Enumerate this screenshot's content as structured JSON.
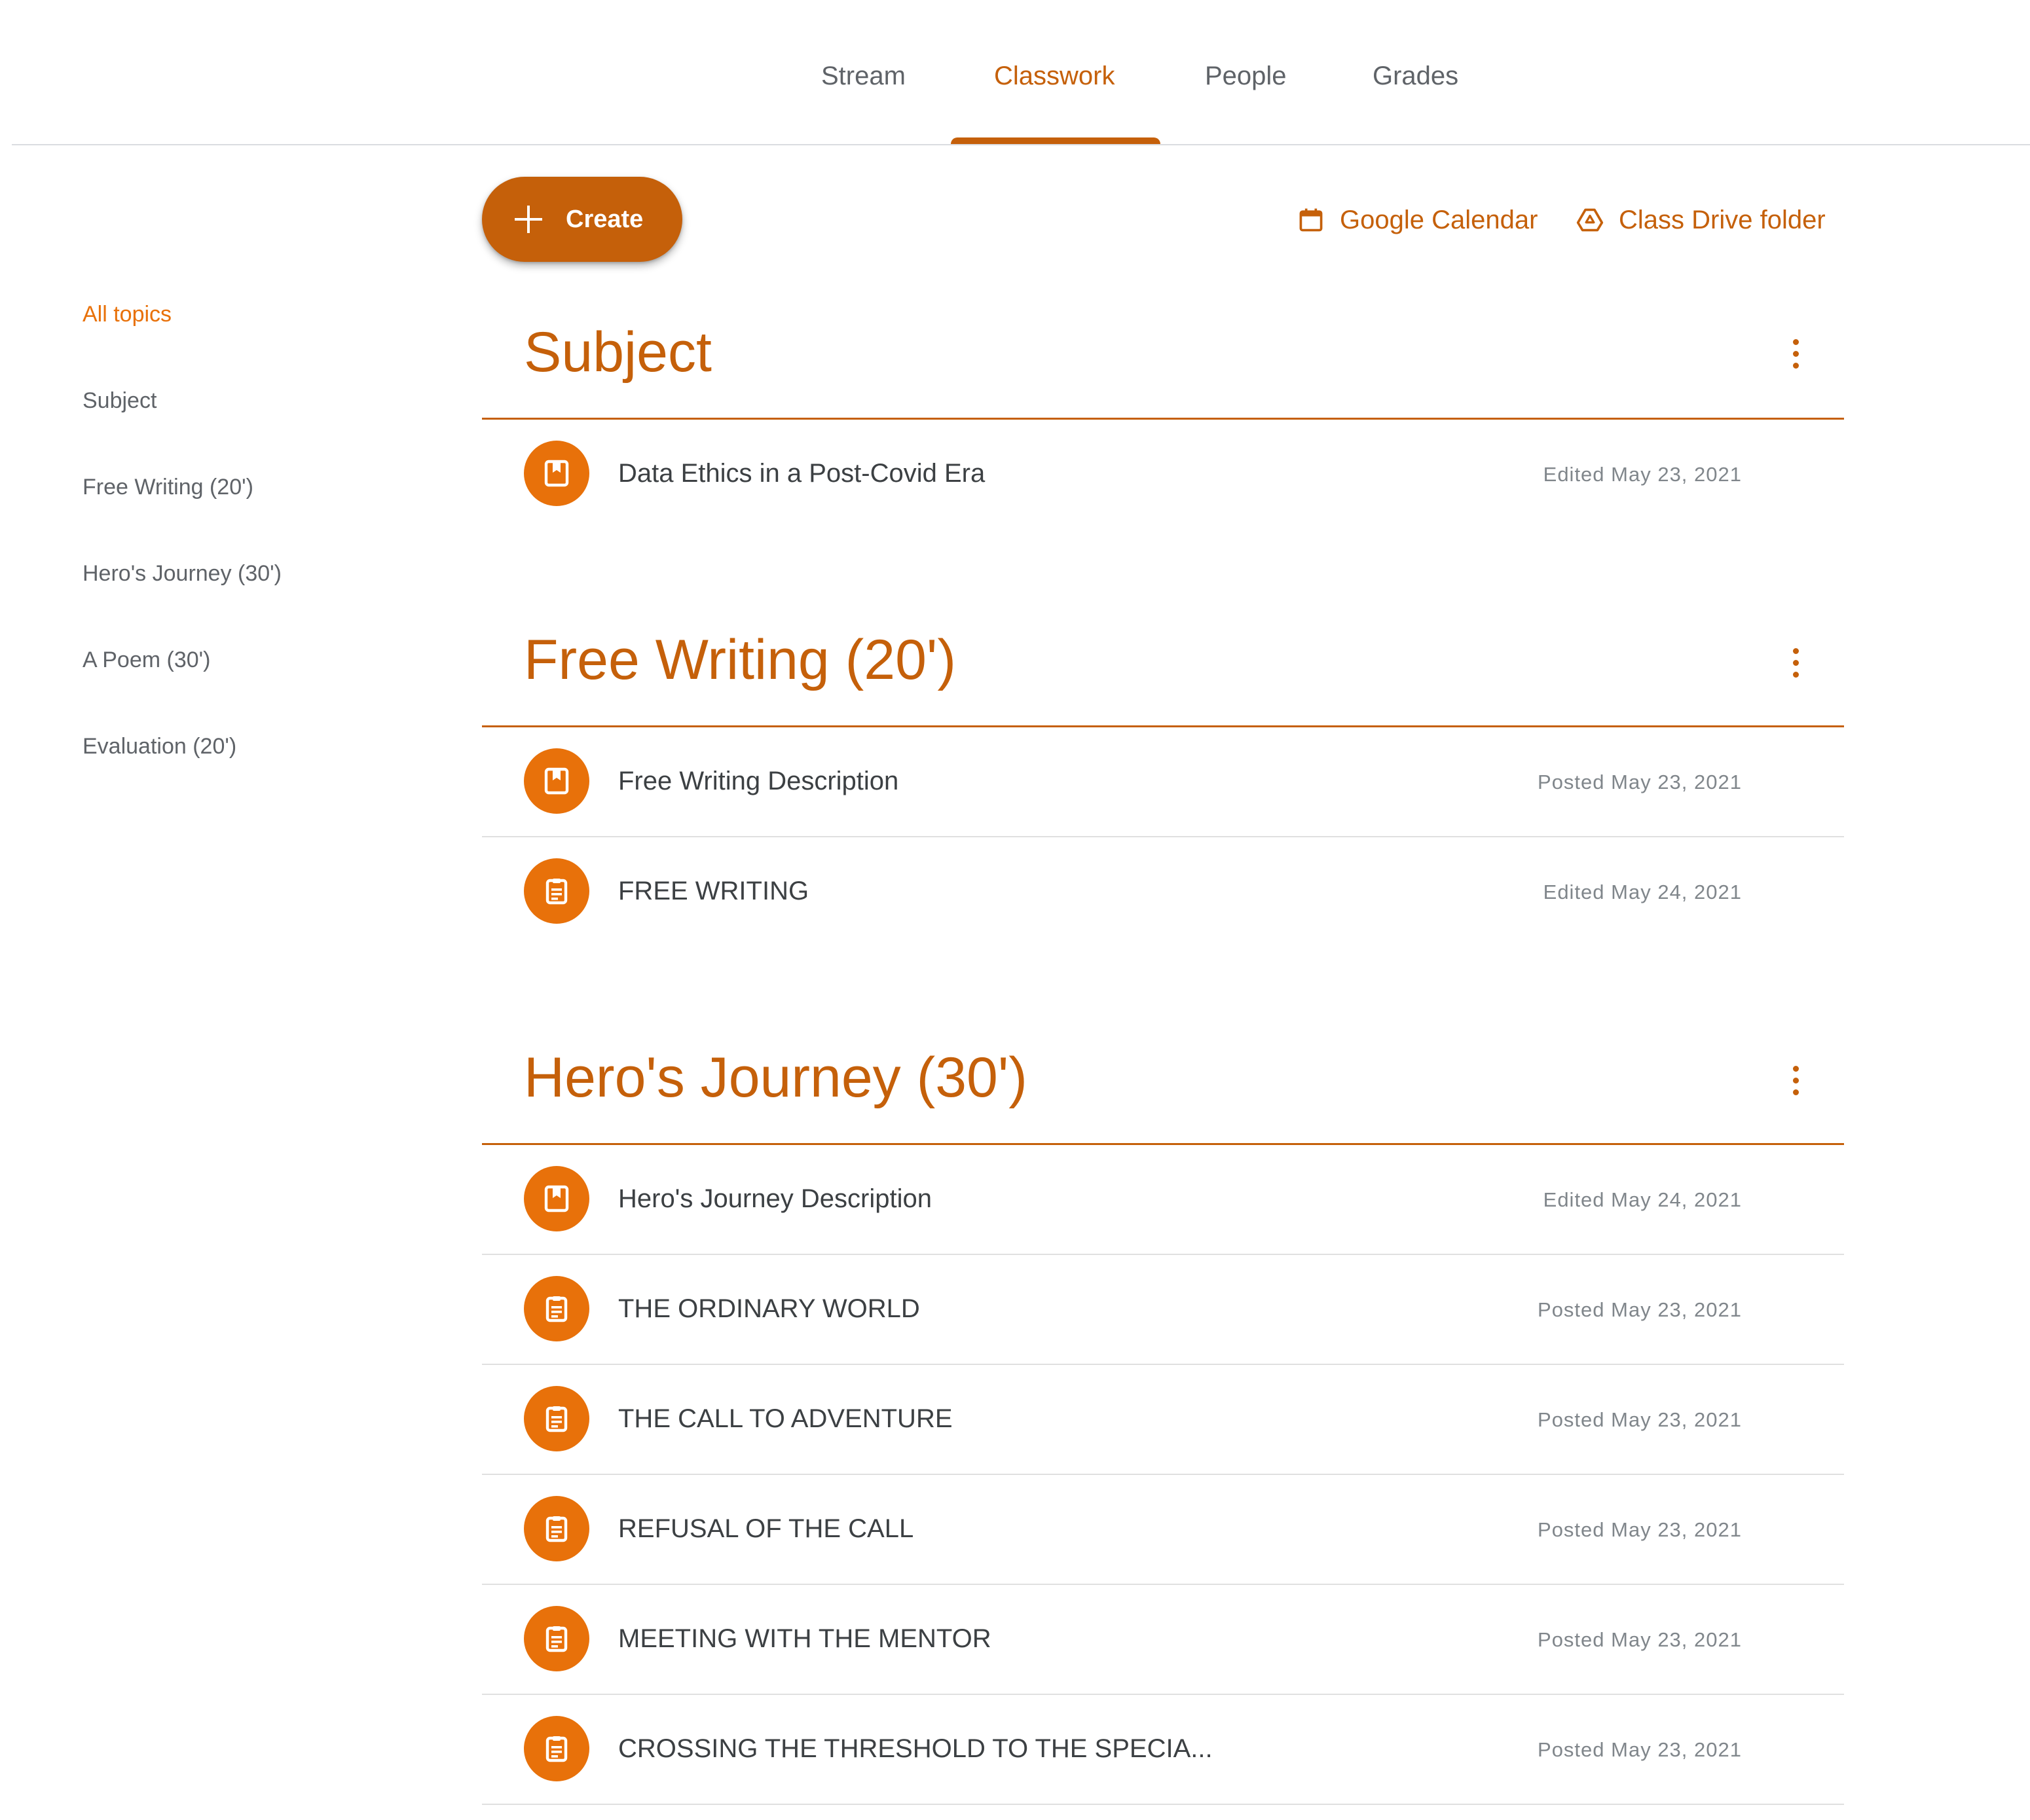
{
  "nav": {
    "tabs": [
      {
        "label": "Stream"
      },
      {
        "label": "Classwork"
      },
      {
        "label": "People"
      },
      {
        "label": "Grades"
      }
    ],
    "active_tab": "Classwork"
  },
  "toolbar": {
    "create_label": "Create",
    "calendar_link": "Google Calendar",
    "drive_link": "Class Drive folder"
  },
  "sidebar": {
    "items": [
      {
        "label": "All topics"
      },
      {
        "label": "Subject"
      },
      {
        "label": "Free Writing (20')"
      },
      {
        "label": "Hero's Journey (30')"
      },
      {
        "label": "A Poem (30')"
      },
      {
        "label": "Evaluation (20')"
      }
    ]
  },
  "topics": [
    {
      "title": "Subject",
      "items": [
        {
          "title": "Data Ethics in a Post-Covid Era",
          "date": "Edited May 23, 2021",
          "icon": "material-icon"
        }
      ]
    },
    {
      "title": "Free Writing (20')",
      "items": [
        {
          "title": "Free Writing Description",
          "date": "Posted May 23, 2021",
          "icon": "material-icon"
        },
        {
          "title": "FREE WRITING",
          "date": "Edited May 24, 2021",
          "icon": "assignment-icon"
        }
      ]
    },
    {
      "title": "Hero's Journey (30')",
      "items": [
        {
          "title": "Hero's Journey Description",
          "date": "Edited May 24, 2021",
          "icon": "material-icon"
        },
        {
          "title": "THE ORDINARY WORLD",
          "date": "Posted May 23, 2021",
          "icon": "assignment-icon"
        },
        {
          "title": "THE CALL TO ADVENTURE",
          "date": "Posted May 23, 2021",
          "icon": "assignment-icon"
        },
        {
          "title": "REFUSAL OF THE CALL",
          "date": "Posted May 23, 2021",
          "icon": "assignment-icon"
        },
        {
          "title": "MEETING WITH THE MENTOR",
          "date": "Posted May 23, 2021",
          "icon": "assignment-icon"
        },
        {
          "title": "CROSSING THE THRESHOLD TO THE SPECIA...",
          "date": "Posted May 23, 2021",
          "icon": "assignment-icon"
        }
      ]
    }
  ],
  "colors": {
    "accent": "#c5600a",
    "icon_badge": "#e8710a",
    "text": "#3c4043",
    "muted": "#80868b"
  }
}
